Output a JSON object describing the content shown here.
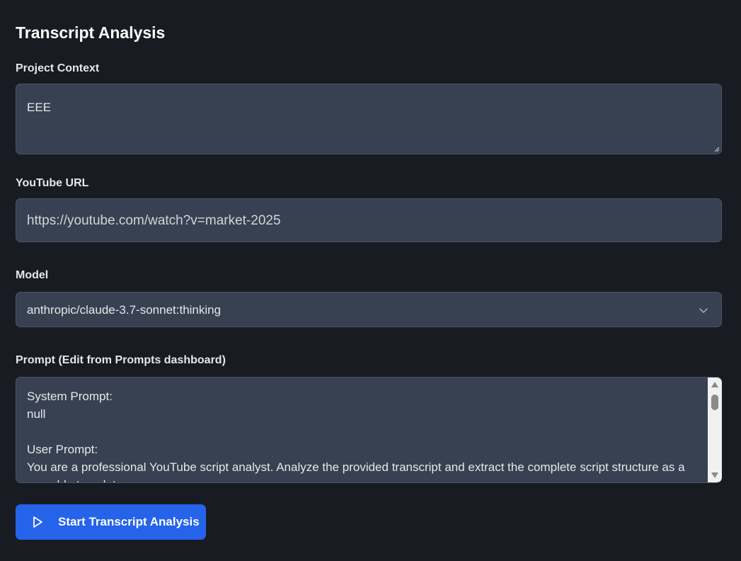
{
  "page": {
    "title": "Transcript Analysis"
  },
  "project_context": {
    "label": "Project Context",
    "value": "EEE"
  },
  "youtube_url": {
    "label": "YouTube URL",
    "value": "https://youtube.com/watch?v=market-2025"
  },
  "model": {
    "label": "Model",
    "selected": "anthropic/claude-3.7-sonnet:thinking"
  },
  "prompt": {
    "label": "Prompt (Edit from Prompts dashboard)",
    "lines": [
      "System Prompt:",
      "null",
      "",
      "User Prompt:",
      "You are a professional YouTube script analyst. Analyze the provided transcript and extract the complete script structure as a reusable template."
    ]
  },
  "action": {
    "start_label": "Start Transcript Analysis"
  },
  "icons": {
    "chevron": "chevron-down-icon",
    "play": "play-icon",
    "resize": "resize-grip-icon"
  },
  "colors": {
    "background": "#181b22",
    "field": "#374151",
    "accent": "#2563eb"
  }
}
